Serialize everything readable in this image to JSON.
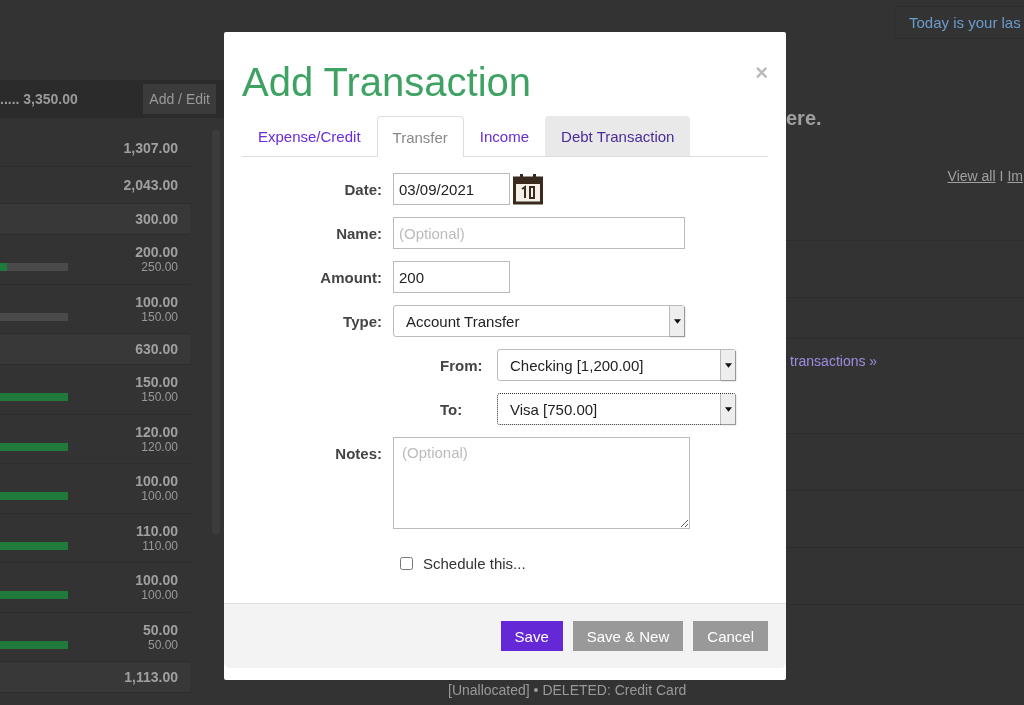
{
  "banner": {
    "text": "Today is your las"
  },
  "budget_panel": {
    "total_label": "..... 3,350.00",
    "edit_button": "Add / Edit",
    "rows": [
      {
        "kind": "total",
        "amount": "1,307.00"
      },
      {
        "kind": "total",
        "amount": "2,043.00"
      },
      {
        "kind": "group",
        "amount": "300.00"
      },
      {
        "kind": "item",
        "amount": "200.00",
        "budget": "250.00",
        "level": 0.1
      },
      {
        "kind": "item",
        "amount": "100.00",
        "budget": "150.00",
        "level": 0
      },
      {
        "kind": "group",
        "amount": "630.00"
      },
      {
        "kind": "item",
        "amount": "150.00",
        "budget": "150.00",
        "level": 1
      },
      {
        "kind": "item",
        "amount": "120.00",
        "budget": "120.00",
        "level": 1
      },
      {
        "kind": "item",
        "amount": "100.00",
        "budget": "100.00",
        "level": 1
      },
      {
        "kind": "item",
        "amount": "110.00",
        "budget": "110.00",
        "level": 1
      },
      {
        "kind": "item",
        "amount": "100.00",
        "budget": "100.00",
        "level": 1
      },
      {
        "kind": "item",
        "amount": "50.00",
        "budget": "50.00",
        "level": 1
      },
      {
        "kind": "group",
        "amount": "1,113.00"
      }
    ]
  },
  "main": {
    "heading": "ere.",
    "view_all": "View all",
    "separator": "I",
    "import_link": "Im",
    "transactions_link": "transactions »",
    "footer_text": "[Unallocated] • DELETED: Credit Card"
  },
  "dialog": {
    "title": "Add Transaction",
    "close": "×",
    "tabs": [
      {
        "label": "Expense/Credit",
        "selected": false,
        "highlighted": false
      },
      {
        "label": "Transfer",
        "selected": true,
        "highlighted": false
      },
      {
        "label": "Income",
        "selected": false,
        "highlighted": false
      },
      {
        "label": "Debt Transaction",
        "selected": false,
        "highlighted": true
      }
    ],
    "date": {
      "label": "Date:",
      "value": "03/09/2021"
    },
    "name": {
      "label": "Name:",
      "placeholder": "(Optional)"
    },
    "amount": {
      "label": "Amount:",
      "value": "200"
    },
    "type": {
      "label": "Type:",
      "value": "Account Transfer",
      "focused": false
    },
    "from": {
      "label": "From:",
      "value": "Checking [1,200.00]",
      "focused": false
    },
    "to": {
      "label": "To:",
      "value": "Visa [750.00]",
      "focused": true
    },
    "notes": {
      "label": "Notes:",
      "placeholder": "(Optional)"
    },
    "schedule": {
      "label": "Schedule this...",
      "checked": false
    },
    "buttons": [
      {
        "label": "Save",
        "kind": "primary"
      },
      {
        "label": "Save & New",
        "kind": "secondary"
      },
      {
        "label": "Cancel",
        "kind": "secondary"
      }
    ]
  }
}
